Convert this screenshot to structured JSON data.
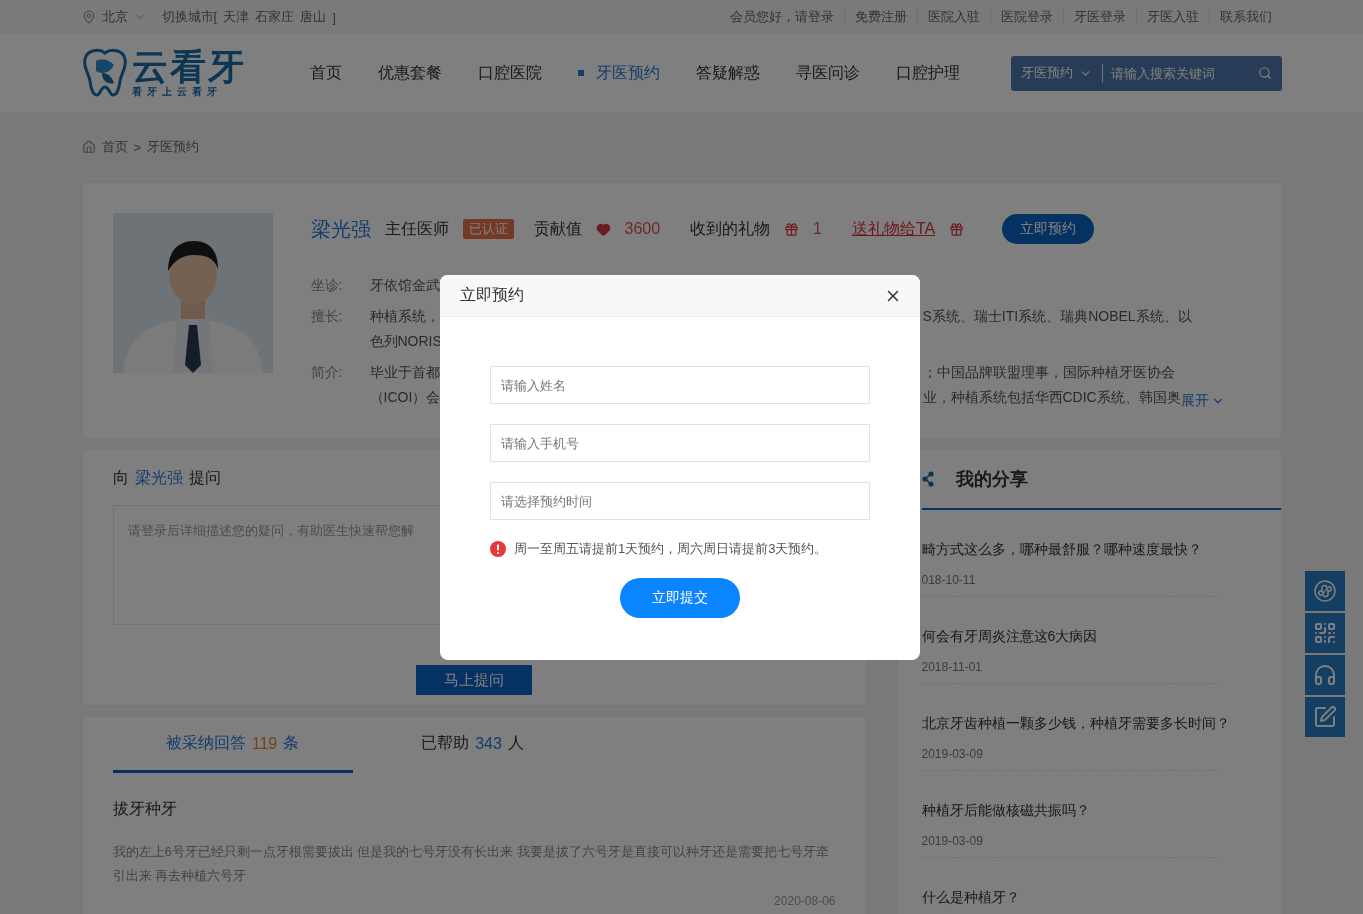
{
  "top_bar": {
    "city": "北京",
    "switch_label": "切换城市[",
    "cities": [
      "天津",
      "石家庄",
      "唐山"
    ],
    "switch_end": "]",
    "links": [
      "会员您好，请登录",
      "免费注册",
      "医院入驻",
      "医院登录",
      "牙医登录",
      "牙医入驻",
      "联系我们"
    ]
  },
  "header": {
    "logo": {
      "name": "云看牙",
      "slogan": "看牙上云看牙"
    },
    "nav": [
      {
        "label": "首页",
        "selected": false
      },
      {
        "label": "优惠套餐",
        "selected": false
      },
      {
        "label": "口腔医院",
        "selected": false
      },
      {
        "label": "牙医预约",
        "selected": true
      },
      {
        "label": "答疑解惑",
        "selected": false
      },
      {
        "label": "寻医问诊",
        "selected": false
      },
      {
        "label": "口腔护理",
        "selected": false
      }
    ],
    "search": {
      "category": "牙医预约",
      "placeholder": "请输入搜索关键词"
    }
  },
  "breadcrumb": {
    "items": [
      "首页",
      "牙医预约"
    ],
    "separator": ">"
  },
  "doctor": {
    "name": "梁光强",
    "title": "主任医师",
    "badge": "已认证",
    "contribution_label": "贡献值",
    "contribution": "3600",
    "gifts_label": "收到的礼物",
    "gifts": "1",
    "gift_link": "送礼物给TA",
    "book_button": "立即预约",
    "details": [
      {
        "label": "坐诊:",
        "lines": [
          {
            "left": "牙依馆金武"
          }
        ]
      },
      {
        "label": "擅长:",
        "lines": [
          {
            "left": "种植系统，",
            "right": "S系统、瑞士ITI系统、瑞典NOBEL系统、以"
          },
          {
            "left": "色列NORIS"
          }
        ]
      },
      {
        "label": "简介:",
        "lines": [
          {
            "left": "毕业于首都",
            "right": "；中国品牌联盟理事，国际种植牙医协会"
          },
          {
            "left": "（ICOI）会",
            "right": "业，种植系统包括华西CDIC系统、韩国奥"
          }
        ]
      }
    ],
    "expand": "展开"
  },
  "ask": {
    "prefix": "向",
    "name": "梁光强",
    "suffix": "提问",
    "placeholder": "请登录后详细描述您的疑问，有助医生快速帮您解",
    "button": "马上提问"
  },
  "answers": {
    "tabs": [
      {
        "label": "被采纳回答",
        "count": "119",
        "unit": "条",
        "selected": true
      },
      {
        "label": "已帮助",
        "count": "343",
        "unit": "人",
        "selected": false
      }
    ],
    "items": [
      {
        "title": "拔牙种牙",
        "body": "我的左上6号牙已经只剩一点牙根需要拔出 但是我的七号牙没有长出来 我要是拔了六号牙是直接可以种牙还是需要把七号牙牵引出来 再去种植六号牙",
        "date": "2020-08-06"
      }
    ]
  },
  "shares": {
    "title": "我的分享",
    "items": [
      {
        "title": "畸方式这么多，哪种最舒服？哪种速度最快？",
        "date": "018-10-11"
      },
      {
        "title": "何会有牙周炎注意这6大病因",
        "date": "2018-11-01"
      },
      {
        "title": "北京牙齿种植一颗多少钱，种植牙需要多长时间？",
        "date": "2019-03-09"
      },
      {
        "title": "种植牙后能做核磁共振吗？",
        "date": "2019-03-09"
      },
      {
        "title": "什么是种植牙？"
      }
    ]
  },
  "side_tools": [
    {
      "kind": "mini-program"
    },
    {
      "kind": "qr"
    },
    {
      "kind": "service"
    },
    {
      "kind": "edit"
    }
  ],
  "modal": {
    "title": "立即预约",
    "fields": [
      {
        "placeholder": "请输入姓名"
      },
      {
        "placeholder": "请输入手机号"
      },
      {
        "placeholder": "请选择预约时间"
      }
    ],
    "notice": "周一至周五请提前1天预约，周六周日请提前3天预约。",
    "submit": "立即提交"
  }
}
